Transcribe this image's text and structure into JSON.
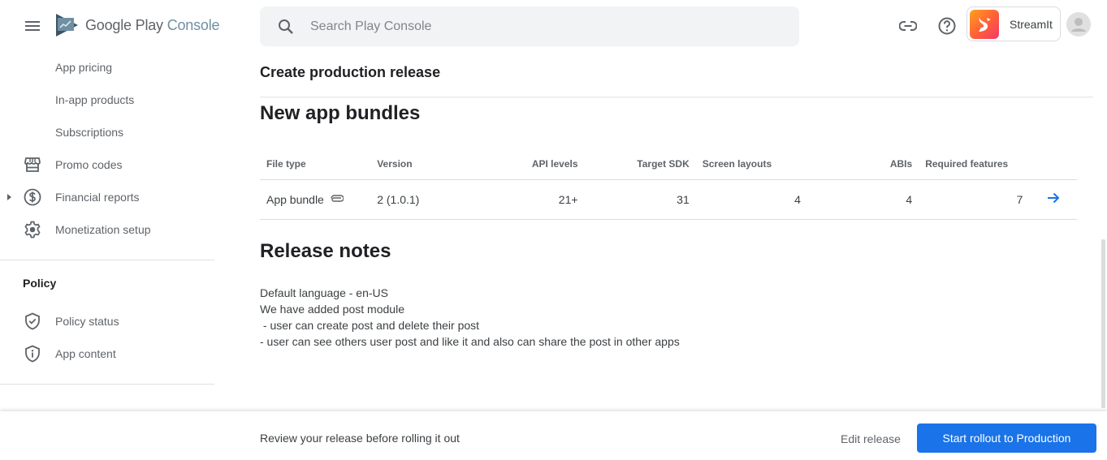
{
  "header": {
    "logo_primary": "Google Play",
    "logo_secondary": "Console",
    "search_placeholder": "Search Play Console",
    "app_name": "StreamIt"
  },
  "sidebar": {
    "items_top": [
      {
        "label": "App pricing"
      },
      {
        "label": "In-app products"
      },
      {
        "label": "Subscriptions"
      },
      {
        "label": "Promo codes",
        "icon": "storefront-icon"
      },
      {
        "label": "Financial reports",
        "icon": "dollar-circle-icon",
        "expandable": true
      },
      {
        "label": "Monetization setup",
        "icon": "gear-icon"
      }
    ],
    "policy_section": {
      "title": "Policy",
      "items": [
        {
          "label": "Policy status",
          "icon": "shield-check-icon"
        },
        {
          "label": "App content",
          "icon": "shield-info-icon"
        }
      ]
    }
  },
  "main": {
    "page_title": "Create production release",
    "bundles_heading": "New app bundles",
    "table": {
      "columns": [
        "File type",
        "Version",
        "API levels",
        "Target SDK",
        "Screen layouts",
        "ABIs",
        "Required features"
      ],
      "rows": [
        {
          "file_type": "App bundle",
          "version": "2 (1.0.1)",
          "api_levels": "21+",
          "target_sdk": "31",
          "screen_layouts": "4",
          "abis": "4",
          "required_features": "7"
        }
      ]
    },
    "release_notes_heading": "Release notes",
    "release_notes": [
      "Default language - en-US",
      "We have added post module",
      " - user can create post and delete their post",
      "- user can see others user post and like it and also can share the post in other apps"
    ]
  },
  "footer": {
    "message": "Review your release before rolling it out",
    "edit_label": "Edit release",
    "rollout_label": "Start rollout to Production"
  },
  "colors": {
    "accent": "#1a73e8",
    "text_primary": "#202124",
    "text_secondary": "#5f6368"
  }
}
